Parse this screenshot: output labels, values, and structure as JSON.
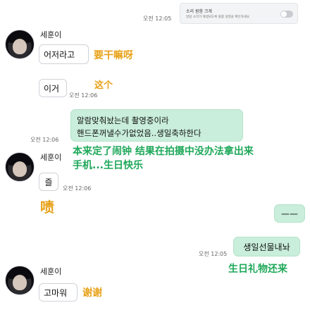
{
  "top": {
    "time": "오전 12:05",
    "notification": {
      "title": "소리 원함 크게",
      "body": "알람 소리가 재생되도록 볼륨 설정을 확인하세요"
    }
  },
  "messages": [
    {
      "sender": "세훈이",
      "text": "어저라고",
      "translation": "要干嘛呀"
    },
    {
      "text": "이거",
      "time": "오전 12:06",
      "translation": "这个"
    },
    {
      "text_line1": "알람맞춰놨는데 촬영중이라",
      "text_line2": "핸드폰꺼낼수가없었음..생일축하한다",
      "time": "오전 12:06",
      "translation_line1": "本来定了闹钟 结果在拍摄中没办法拿出来",
      "translation_line2": "手机...生日快乐"
    },
    {
      "sender": "세훈이",
      "text": "즐",
      "time": "오전 12:06",
      "translation": "啧"
    },
    {
      "text": "ㅡㅡ"
    },
    {
      "text": "생일선물내놔",
      "time": "오전 12:05",
      "translation": "生日礼物还来"
    },
    {
      "sender": "세훈이",
      "text": "고마워",
      "translation": "谢谢"
    }
  ]
}
